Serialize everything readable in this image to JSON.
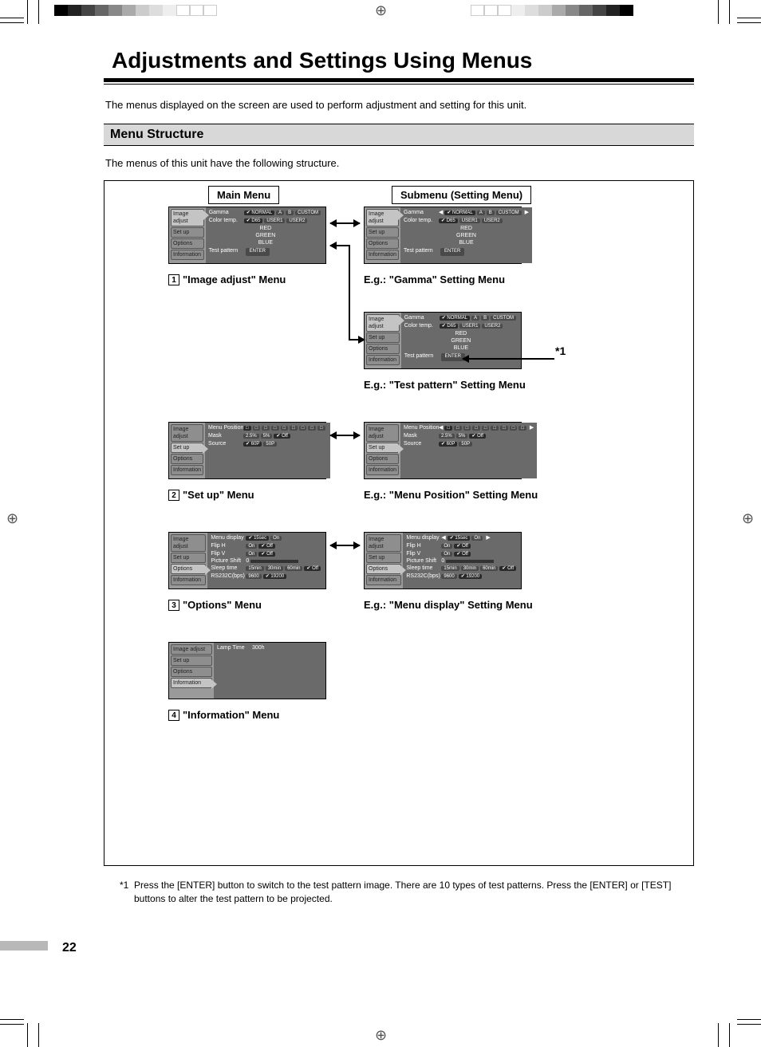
{
  "title": "Adjustments and Settings Using Menus",
  "intro": "The menus displayed on the screen are used to perform adjustment and setting for this unit.",
  "section_heading": "Menu Structure",
  "subintro": "The menus of this unit have the following structure.",
  "col_left": "Main Menu",
  "col_right": "Submenu (Setting Menu)",
  "captions": {
    "c1": "\"Image adjust\" Menu",
    "c1r": "E.g.: \"Gamma\" Setting Menu",
    "c1r2": "E.g.: \"Test pattern\" Setting Menu",
    "c2": "\"Set up\" Menu",
    "c2r": "E.g.: \"Menu Position\" Setting Menu",
    "c3": "\"Options\" Menu",
    "c3r": "E.g.: \"Menu display\" Setting Menu",
    "c4": "\"Information\" Menu"
  },
  "nums": {
    "n1": "1",
    "n2": "2",
    "n3": "3",
    "n4": "4"
  },
  "star_label": "*1",
  "footnote_label": "*1",
  "footnote": "Press the [ENTER] button to switch to the test pattern image. There are 10 types of test patterns. Press the [ENTER] or [TEST] buttons to alter the test pattern to be projected.",
  "page_num": "22",
  "side_items": [
    "Image adjust",
    "Set up",
    "Options",
    "Information"
  ],
  "image_adjust": {
    "sel": 0,
    "rows": [
      {
        "label": "Gamma",
        "opts": [
          "NORMAL",
          "A",
          "B",
          "CUSTOM"
        ],
        "sel": 0
      },
      {
        "label": "Color temp.",
        "opts": [
          "D65",
          "USER1",
          "USER2"
        ],
        "sel": 0
      }
    ],
    "colors": [
      "RED",
      "GREEN",
      "BLUE"
    ],
    "test": "Test pattern",
    "enter": "ENTER"
  },
  "gamma_sub": {
    "sel": 0,
    "rows": [
      {
        "label": "Gamma",
        "opts": [
          "NORMAL",
          "A",
          "B",
          "CUSTOM"
        ],
        "sel": 0,
        "cursor": true
      },
      {
        "label": "Color temp.",
        "opts": [
          "D65",
          "USER1",
          "USER2"
        ],
        "sel": 0
      }
    ],
    "colors": [
      "RED",
      "GREEN",
      "BLUE"
    ],
    "test": "Test pattern",
    "enter": "ENTER"
  },
  "test_sub": {
    "sel": 0,
    "rows": [
      {
        "label": "Gamma",
        "opts": [
          "NORMAL",
          "A",
          "B",
          "CUSTOM"
        ],
        "sel": 0
      },
      {
        "label": "Color temp.",
        "opts": [
          "D65",
          "USER1",
          "USER2"
        ],
        "sel": 0
      }
    ],
    "colors": [
      "RED",
      "GREEN",
      "BLUE"
    ],
    "test": "Test pattern",
    "enter": "ENTER",
    "hl_test": true
  },
  "setup": {
    "sel": 1,
    "rows": [
      {
        "label": "Menu Position",
        "opts": [
          "",
          "",
          "",
          "",
          "",
          "",
          "",
          "",
          ""
        ],
        "sel": 0
      },
      {
        "label": "Mask",
        "opts": [
          "2.5%",
          "5%",
          "Off"
        ],
        "sel": 2
      },
      {
        "label": "Source",
        "opts": [
          "60P",
          "50P"
        ],
        "sel": 0
      }
    ]
  },
  "setup_sub": {
    "sel": 1,
    "rows": [
      {
        "label": "Menu Position",
        "opts": [
          "",
          "",
          "",
          "",
          "",
          "",
          "",
          "",
          ""
        ],
        "sel": 0,
        "cursor": true
      },
      {
        "label": "Mask",
        "opts": [
          "2.5%",
          "5%",
          "Off"
        ],
        "sel": 2
      },
      {
        "label": "Source",
        "opts": [
          "60P",
          "50P"
        ],
        "sel": 0
      }
    ]
  },
  "options": {
    "sel": 2,
    "rows": [
      {
        "label": "Menu display",
        "opts": [
          "15sec",
          "On"
        ],
        "sel": 0
      },
      {
        "label": "Flip H",
        "opts": [
          "On",
          "Off"
        ],
        "sel": 1
      },
      {
        "label": "Flip V",
        "opts": [
          "On",
          "Off"
        ],
        "sel": 1
      },
      {
        "label": "Picture Shift",
        "bar": true,
        "val": "0"
      },
      {
        "label": "Sleep time",
        "opts": [
          "15min",
          "30min",
          "60min",
          "Off"
        ],
        "sel": 3
      },
      {
        "label": "RS232C(bps)",
        "opts": [
          "9600",
          "19200"
        ],
        "sel": 1
      }
    ]
  },
  "options_sub": {
    "sel": 2,
    "rows": [
      {
        "label": "Menu display",
        "opts": [
          "15sec",
          "On"
        ],
        "sel": 0,
        "cursor": true
      },
      {
        "label": "Flip H",
        "opts": [
          "On",
          "Off"
        ],
        "sel": 1
      },
      {
        "label": "Flip V",
        "opts": [
          "On",
          "Off"
        ],
        "sel": 1
      },
      {
        "label": "Picture Shift",
        "bar": true,
        "val": "0"
      },
      {
        "label": "Sleep time",
        "opts": [
          "15min",
          "30min",
          "60min",
          "Off"
        ],
        "sel": 3
      },
      {
        "label": "RS232C(bps)",
        "opts": [
          "9600",
          "19200"
        ],
        "sel": 1
      }
    ]
  },
  "information": {
    "sel": 3,
    "rows": [
      {
        "label": "Lamp Time",
        "value": "300h"
      }
    ]
  }
}
